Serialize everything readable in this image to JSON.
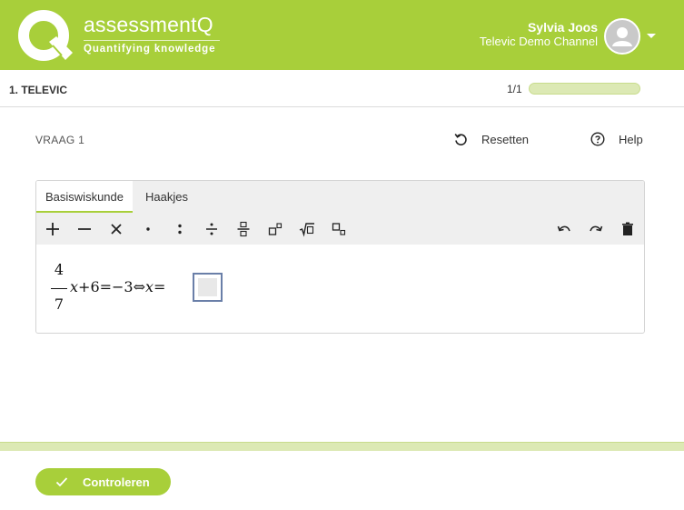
{
  "header": {
    "brand_name": "assessmentQ",
    "brand_tagline": "Quantifying knowledge",
    "user_name": "Sylvia Joos",
    "user_channel": "Televic Demo Channel",
    "brand_color": "#a8cf3a"
  },
  "section": {
    "title": "1. TELEVIC",
    "page_count": "1/1",
    "progress": 1.0
  },
  "question": {
    "label": "VRAAG 1",
    "reset_label": "Resetten",
    "help_label": "Help"
  },
  "editor": {
    "tabs": [
      {
        "label": "Basiswiskunde",
        "active": true
      },
      {
        "label": "Haakjes",
        "active": false
      }
    ],
    "tools": [
      "plus-icon",
      "minus-icon",
      "times-icon",
      "dot-icon",
      "colon-icon",
      "divide-icon",
      "fraction-icon",
      "power-icon",
      "sqrt-icon",
      "subscript-icon"
    ],
    "actions": [
      "undo-icon",
      "redo-icon",
      "trash-icon"
    ],
    "expression": {
      "numerator": "4",
      "denominator": "7",
      "var1": "x",
      "part1": "+6=−3⇔",
      "var2": "x",
      "part2": "="
    }
  },
  "footer": {
    "check_label": "Controleren"
  }
}
